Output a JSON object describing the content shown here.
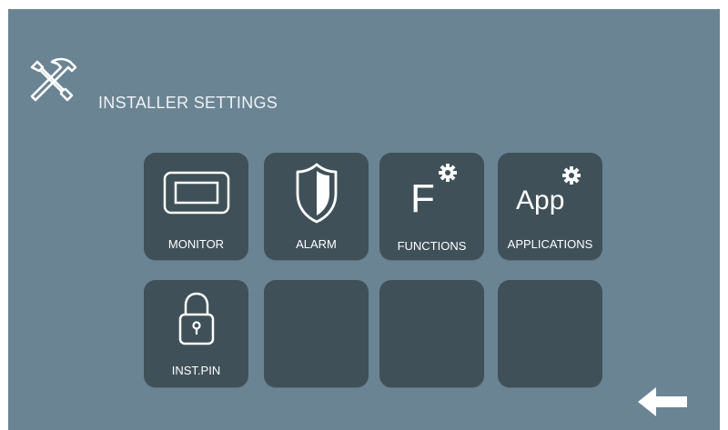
{
  "header": {
    "title": "INSTALLER SETTINGS",
    "icon": "tools-icon"
  },
  "tiles": [
    {
      "label": "MONITOR",
      "icon": "monitor-icon"
    },
    {
      "label": "ALARM",
      "icon": "shield-icon"
    },
    {
      "label": "FUNCTIONS",
      "icon": "functions-icon",
      "glyph": "F"
    },
    {
      "label": "APPLICATIONS",
      "icon": "applications-icon",
      "glyph": "App"
    },
    {
      "label": "INST.PIN",
      "icon": "padlock-icon"
    },
    {
      "label": "",
      "icon": ""
    },
    {
      "label": "",
      "icon": ""
    },
    {
      "label": "",
      "icon": ""
    }
  ],
  "footer": {
    "back_icon": "back-arrow-icon"
  },
  "colors": {
    "background": "#6a8494",
    "tile": "#3f5058",
    "foreground": "#ffffff"
  }
}
